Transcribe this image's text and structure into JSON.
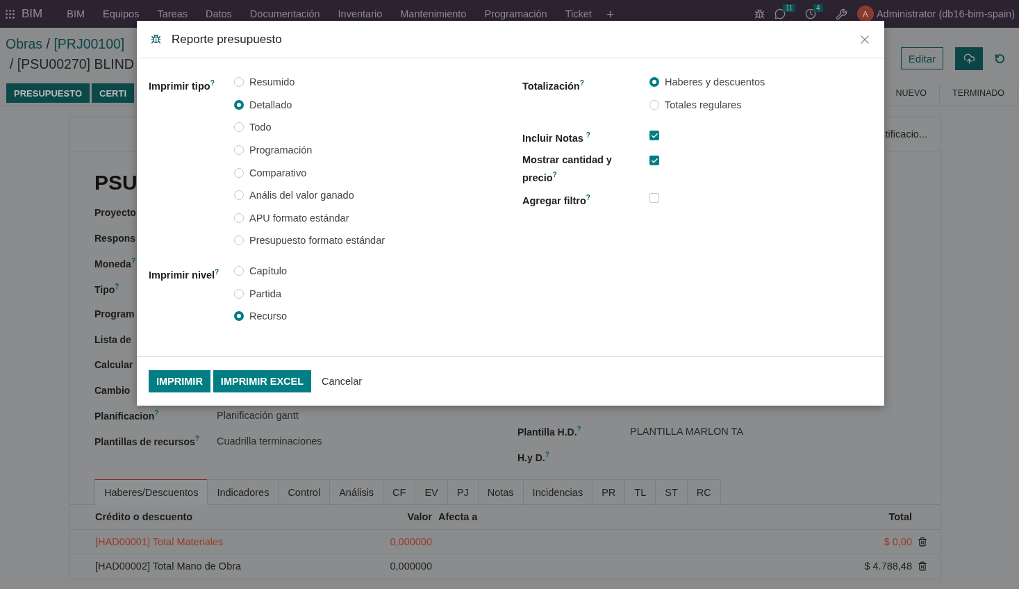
{
  "navbar": {
    "app_name": "BIM",
    "menu": [
      "BIM",
      "Equipos",
      "Tareas",
      "Datos",
      "Documentación",
      "Inventario",
      "Mantenimiento",
      "Programación",
      "Ticket"
    ],
    "chat_count": "11",
    "activity_count": "4",
    "user_initial": "A",
    "user_name": "Administrator (db16-bim-spain)"
  },
  "breadcrumb": {
    "root": "Obras",
    "separator": "/",
    "project": "[PRJ00100]",
    "current": "/ [PSU00270] BLIND"
  },
  "actions": {
    "edit": "Editar"
  },
  "header_buttons": [
    "PRESUPUESTO",
    "CERTI"
  ],
  "stages": [
    {
      "label": "NUEVO",
      "selected": false
    },
    {
      "label": "TERMINADO",
      "selected": false
    }
  ],
  "sheet": {
    "smart_button": "tificacio...",
    "title": "PSU",
    "left_fields": [
      {
        "label": "Proyecto"
      },
      {
        "label": "Respons"
      },
      {
        "label": "Moneda$^{?}$"
      },
      {
        "label": "Tipo$^{?}$"
      },
      {
        "label": "Program"
      },
      {
        "label": "Lista de"
      },
      {
        "label": "Calcular"
      },
      {
        "label": "Cambio"
      },
      {
        "label": "Planificacion$^{?}$",
        "value": "Planificación gantt"
      },
      {
        "label": "Plantillas de recursos$^{?}$",
        "value": "Cuadrilla terminaciones"
      }
    ],
    "right_fields": [
      {
        "label": "Plantilla H.D.$^{?}$",
        "value": "PLANTILLA MARLON TA"
      },
      {
        "label": "H.y D.$^{?}$"
      }
    ],
    "tabs": [
      {
        "label": "Haberes/Descuentos",
        "selected": true
      },
      {
        "label": "Indicadores",
        "selected": false
      },
      {
        "label": "Control",
        "selected": false
      },
      {
        "label": "Análisis",
        "selected": false
      },
      {
        "label": "CF",
        "selected": false
      },
      {
        "label": "EV",
        "selected": false
      },
      {
        "label": "PJ",
        "selected": false
      },
      {
        "label": "Notas",
        "selected": false
      },
      {
        "label": "Incidencias",
        "selected": false
      },
      {
        "label": "PR",
        "selected": false
      },
      {
        "label": "TL",
        "selected": false
      },
      {
        "label": "ST",
        "selected": false
      },
      {
        "label": "RC",
        "selected": false
      }
    ],
    "table": {
      "columns": [
        "Crédito o descuento",
        "Valor",
        "Afecta a",
        "Total"
      ],
      "rows": [
        {
          "credit": "[HAD00001] Total Materiales",
          "value": "0,000000",
          "total": "$ 0,00",
          "color": "#9a3a28"
        },
        {
          "credit": "[HAD00002] Total Mano de Obra",
          "value": "0,000000",
          "total": "$ 4.788,48",
          "color": "#1f1f1f"
        }
      ]
    }
  },
  "dialog": {
    "title": "Reporte presupuesto",
    "left_groups": [
      {
        "label": "Imprimir tipo$^{?}$",
        "options": [
          {
            "label": "Resumido",
            "selected": false
          },
          {
            "label": "Detallado",
            "selected": true
          },
          {
            "label": "Todo",
            "selected": false
          },
          {
            "label": "Programación",
            "selected": false
          },
          {
            "label": "Comparativo",
            "selected": false
          },
          {
            "label": "Anális del valor ganado",
            "selected": false
          },
          {
            "label": "APU formato estándar",
            "selected": false
          },
          {
            "label": "Presupuesto formato estándar",
            "selected": false
          }
        ]
      },
      {
        "label": "Imprimir nivel$^{?}$",
        "options": [
          {
            "label": "Capítulo",
            "selected": false
          },
          {
            "label": "Partida",
            "selected": false
          },
          {
            "label": "Recurso",
            "selected": true
          }
        ]
      }
    ],
    "right_fields": [
      {
        "kind": "radio",
        "label": "Totalización$^{?}$",
        "options": [
          {
            "label": "Haberes y descuentos",
            "selected": true
          },
          {
            "label": "Totales regulares",
            "selected": false
          }
        ]
      },
      {
        "kind": "checkbox",
        "label": "Incluir Notas $^{?}$",
        "checked": true
      },
      {
        "kind": "checkbox",
        "label": "Mostrar cantidad y precio$^{?}$",
        "checked": true
      },
      {
        "kind": "checkbox",
        "label": "Agregar filtro$^{?}$",
        "checked": false
      }
    ],
    "buttons": [
      {
        "label": "IMPRIMIR",
        "kind": "primary"
      },
      {
        "label": "IMPRIMIR EXCEL",
        "kind": "primary"
      },
      {
        "label": "Cancelar",
        "kind": "link"
      }
    ]
  }
}
